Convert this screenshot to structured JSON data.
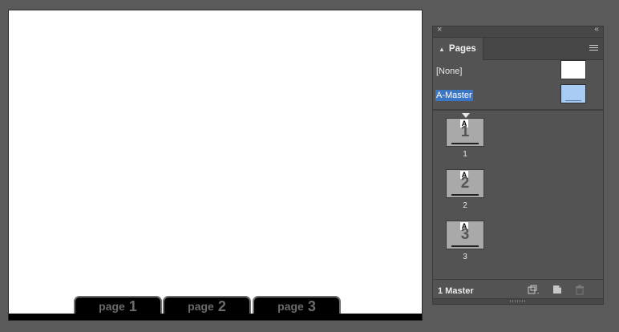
{
  "document": {
    "tabs": [
      {
        "word": "page",
        "number": "1"
      },
      {
        "word": "page",
        "number": "2"
      },
      {
        "word": "page",
        "number": "3"
      }
    ]
  },
  "panel": {
    "close_glyph": "×",
    "collapse_glyph": "‹‹",
    "title": "Pages",
    "masters": [
      {
        "label": "[None]",
        "selected": false
      },
      {
        "label": "A-Master",
        "selected": true
      }
    ],
    "pages": [
      {
        "master_prefix": "A",
        "thumb_number": "1",
        "label": "1"
      },
      {
        "master_prefix": "A",
        "thumb_number": "2",
        "label": "2"
      },
      {
        "master_prefix": "A",
        "thumb_number": "3",
        "label": "3"
      }
    ],
    "footer": {
      "status": "1 Master"
    },
    "icons": [
      "close-icon",
      "collapse-icon",
      "updown-icon",
      "panel-menu-icon",
      "page-size-icon",
      "new-page-icon",
      "trash-icon"
    ]
  }
}
